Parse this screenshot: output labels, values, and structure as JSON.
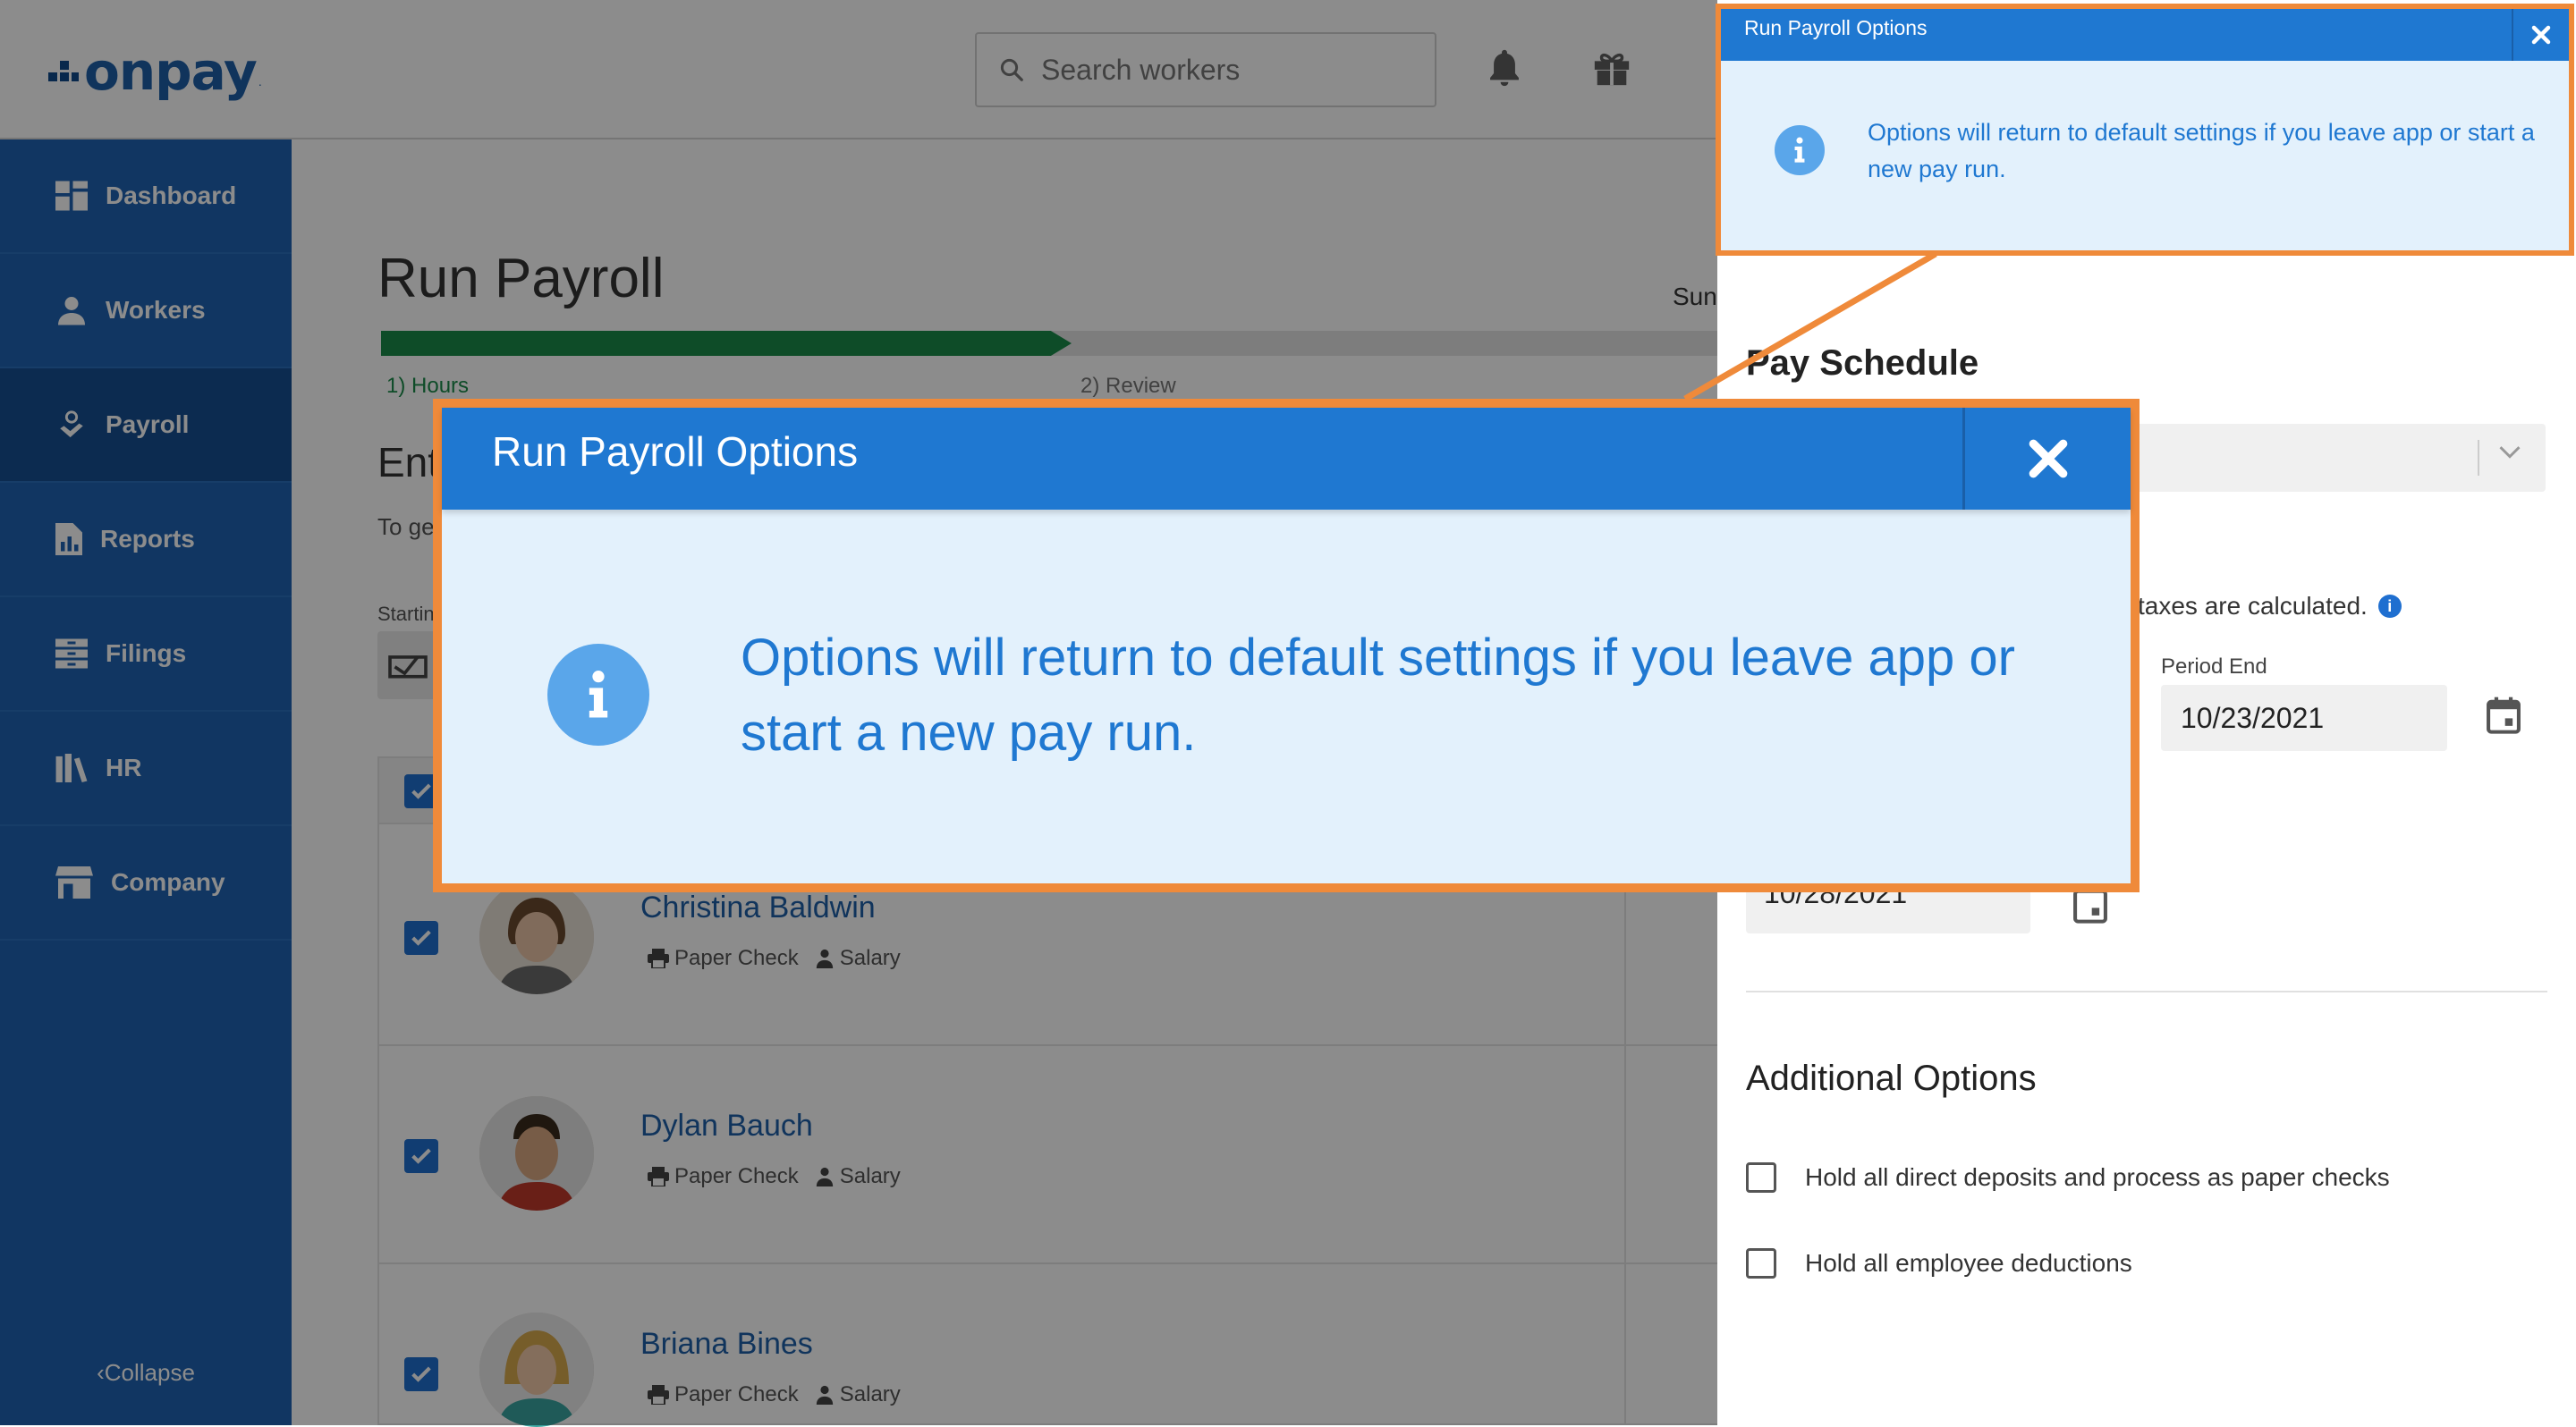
{
  "header": {
    "logo_text": "onpay",
    "logo_mark": ".",
    "search_placeholder": "Search workers"
  },
  "sidebar": {
    "items": [
      {
        "label": "Dashboard",
        "icon": "dashboard-icon"
      },
      {
        "label": "Workers",
        "icon": "workers-icon"
      },
      {
        "label": "Payroll",
        "icon": "payroll-icon",
        "active": true
      },
      {
        "label": "Reports",
        "icon": "reports-icon"
      },
      {
        "label": "Filings",
        "icon": "filings-icon"
      },
      {
        "label": "HR",
        "icon": "hr-icon"
      },
      {
        "label": "Company",
        "icon": "company-icon"
      }
    ],
    "collapse_label": "Collapse"
  },
  "main": {
    "title": "Run Payroll",
    "progress_fraction": 0.5,
    "steps": [
      "1) Hours",
      "2) Review"
    ],
    "step_summary_partial": "Sun",
    "section_title_partial": "Ent",
    "section_desc_partial": "To ge",
    "start_label_partial": "Startin",
    "workers": [
      {
        "name": "Christina Baldwin",
        "pay_method": "Paper Check",
        "type": "Salary"
      },
      {
        "name": "Dylan Bauch",
        "pay_method": "Paper Check",
        "type": "Salary"
      },
      {
        "name": "Briana Bines",
        "pay_method": "Paper Check",
        "type": "Salary"
      }
    ]
  },
  "panel": {
    "pay_schedule_title": "Pay Schedule",
    "taxes_text": "taxes are calculated.",
    "period_end_label": "Period End",
    "period_end_value": "10/23/2021",
    "check_date_value": "10/28/2021",
    "additional_options_title": "Additional Options",
    "options": [
      {
        "label": "Hold all direct deposits and process as paper checks",
        "checked": false
      },
      {
        "label": "Hold all employee deductions",
        "checked": false
      }
    ]
  },
  "popup": {
    "title": "Run Payroll Options",
    "message": "Options will return to default settings if you leave app or start a new pay run."
  },
  "colors": {
    "brand_blue": "#1f78d1",
    "sidebar_blue": "#1f63b2",
    "highlight_orange": "#ef8a3a",
    "progress_green": "#1a8a4a",
    "info_bg": "#e3f1fc"
  }
}
